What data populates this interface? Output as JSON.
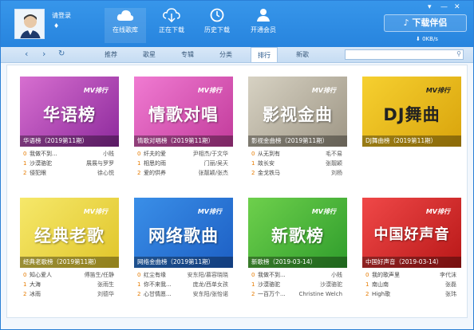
{
  "header": {
    "login_label": "请登录",
    "gem_icon": "diamond-icon",
    "nav": [
      {
        "label": "在线歌库",
        "icon": "cloud-icon"
      },
      {
        "label": "正在下载",
        "icon": "download-icon"
      },
      {
        "label": "历史下载",
        "icon": "history-icon"
      },
      {
        "label": "开通会员",
        "icon": "user-icon"
      }
    ],
    "brand": "下载伴侣",
    "speed": "0KB/s"
  },
  "toolbar": {
    "back": "‹",
    "forward": "›",
    "refresh": "↻",
    "tabs": [
      "推荐",
      "歌星",
      "专辑",
      "分类",
      "排行",
      "新歌"
    ],
    "active_tab": "排行",
    "search_placeholder": ""
  },
  "colors": {
    "accent": "#2784de",
    "number": "#e67b00"
  },
  "charts": [
    {
      "banner_text": "华语榜",
      "mv_badge": "MV排行",
      "caption": "华语榜（2019第11期）",
      "songs": [
        {
          "no": "0",
          "title": "我做不到...",
          "artist": "小贱"
        },
        {
          "no": "1",
          "title": "沙漠骆驼",
          "artist": "展展与罗罗"
        },
        {
          "no": "2",
          "title": "侵犯眼",
          "artist": "徐心悦"
        }
      ]
    },
    {
      "banner_text": "情歌对唱",
      "mv_badge": "MV排行",
      "caption": "情歌对唱榜（2019第11期）",
      "songs": [
        {
          "no": "0",
          "title": "纤夫的爱",
          "artist": "尹相杰/于文华"
        },
        {
          "no": "1",
          "title": "相思的雨",
          "artist": "门丽/吴天"
        },
        {
          "no": "2",
          "title": "爱的供养",
          "artist": "张靓颖/张杰"
        }
      ]
    },
    {
      "banner_text": "影视金曲",
      "mv_badge": "MV排行",
      "caption": "影视金曲榜（2019第11期）",
      "songs": [
        {
          "no": "0",
          "title": "从无到有",
          "artist": "毛不易"
        },
        {
          "no": "1",
          "title": "故长安",
          "artist": "张靓颖"
        },
        {
          "no": "2",
          "title": "金戈铁马",
          "artist": "刘杨"
        }
      ]
    },
    {
      "banner_text": "DJ舞曲",
      "mv_badge": "MV排行",
      "caption": "DJ舞曲榜（2019第11期）",
      "songs": []
    },
    {
      "banner_text": "经典老歌",
      "mv_badge": "MV排行",
      "caption": "经典老歌榜（2019第11期）",
      "songs": [
        {
          "no": "0",
          "title": "知心爱人",
          "artist": "傅笛生/任静"
        },
        {
          "no": "1",
          "title": "大海",
          "artist": "张雨生"
        },
        {
          "no": "2",
          "title": "冰雨",
          "artist": "刘德华"
        }
      ]
    },
    {
      "banner_text": "网络歌曲",
      "mv_badge": "MV排行",
      "caption": "网络金曲榜（2019第11期）",
      "songs": [
        {
          "no": "0",
          "title": "红尘有缘",
          "artist": "安东阳/慕容晓晓"
        },
        {
          "no": "1",
          "title": "你不来我...",
          "artist": "庞龙/西单女孩"
        },
        {
          "no": "2",
          "title": "心甘情愿...",
          "artist": "安东阳/张怡诺"
        }
      ]
    },
    {
      "banner_text": "新歌榜",
      "mv_badge": "MV排行",
      "caption": "新歌榜（2019-03-14）",
      "songs": [
        {
          "no": "0",
          "title": "我做不到...",
          "artist": "小贱"
        },
        {
          "no": "1",
          "title": "沙漠骆驼",
          "artist": "沙漠骆驼"
        },
        {
          "no": "2",
          "title": "一百万个...",
          "artist": "Christine Welch"
        }
      ]
    },
    {
      "banner_text": "中国好声音",
      "mv_badge": "MV排行",
      "caption": "中国好声音（2019-03-14）",
      "songs": [
        {
          "no": "0",
          "title": "我的歌声里",
          "artist": "李代沫"
        },
        {
          "no": "1",
          "title": "南山南",
          "artist": "张磊"
        },
        {
          "no": "2",
          "title": "High歌",
          "artist": "张玮"
        }
      ]
    }
  ]
}
